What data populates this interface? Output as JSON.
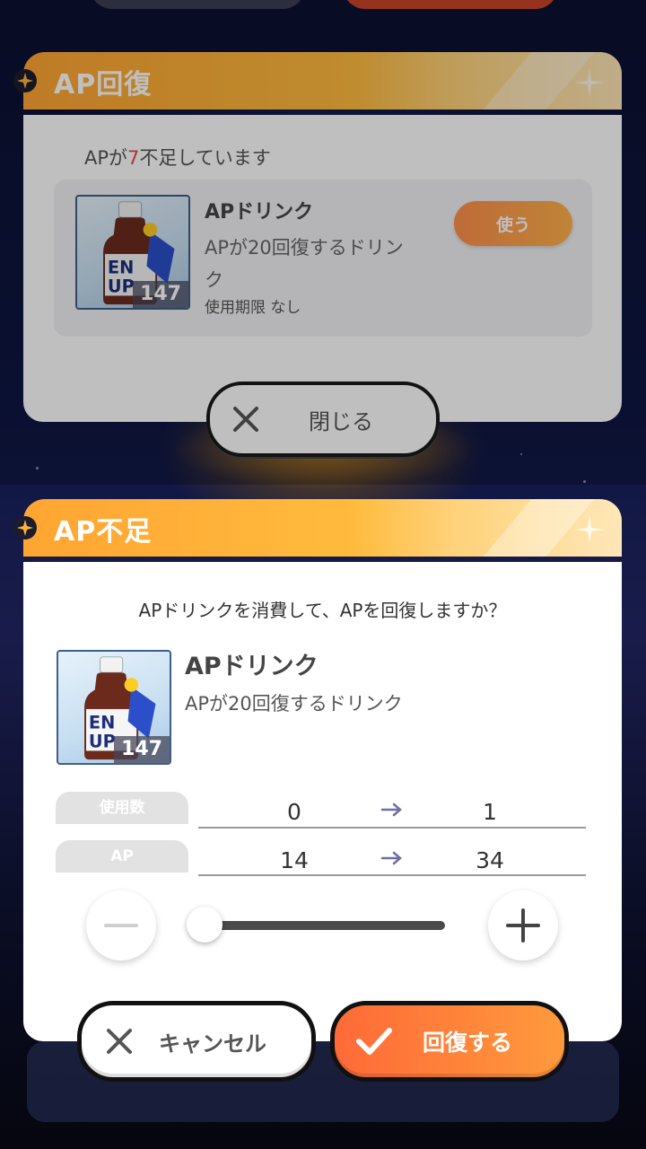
{
  "colors": {
    "accent_orange": "#ff8a3a",
    "header_orange": "#ffa532",
    "shortage_number": "#e8444c",
    "label_tab_gray": "#e2e2e2"
  },
  "back_dialog": {
    "title": "AP回復",
    "shortage_prefix": "APが",
    "shortage_number": "7",
    "shortage_suffix": "不足しています",
    "item": {
      "name": "APドリンク",
      "description_line1": "APが20回復するドリン",
      "description_line2": "ク",
      "expiry": "使用期限 なし",
      "count": "147",
      "icon": "drink-bottle-icon"
    },
    "use_button": "使う",
    "close_button": "閉じる"
  },
  "front_dialog": {
    "title": "AP不足",
    "question": "APドリンクを消費して、APを回復しますか？",
    "item": {
      "name": "APドリンク",
      "description": "APが20回復するドリンク",
      "count": "147",
      "icon": "drink-bottle-icon"
    },
    "rows": [
      {
        "label": "使用数",
        "from": "0",
        "to": "1"
      },
      {
        "label": "AP",
        "from": "14",
        "to": "34"
      }
    ],
    "slider": {
      "min": 0,
      "max": 147,
      "value": 1
    },
    "cancel_button": "キャンセル",
    "confirm_button": "回復する"
  }
}
